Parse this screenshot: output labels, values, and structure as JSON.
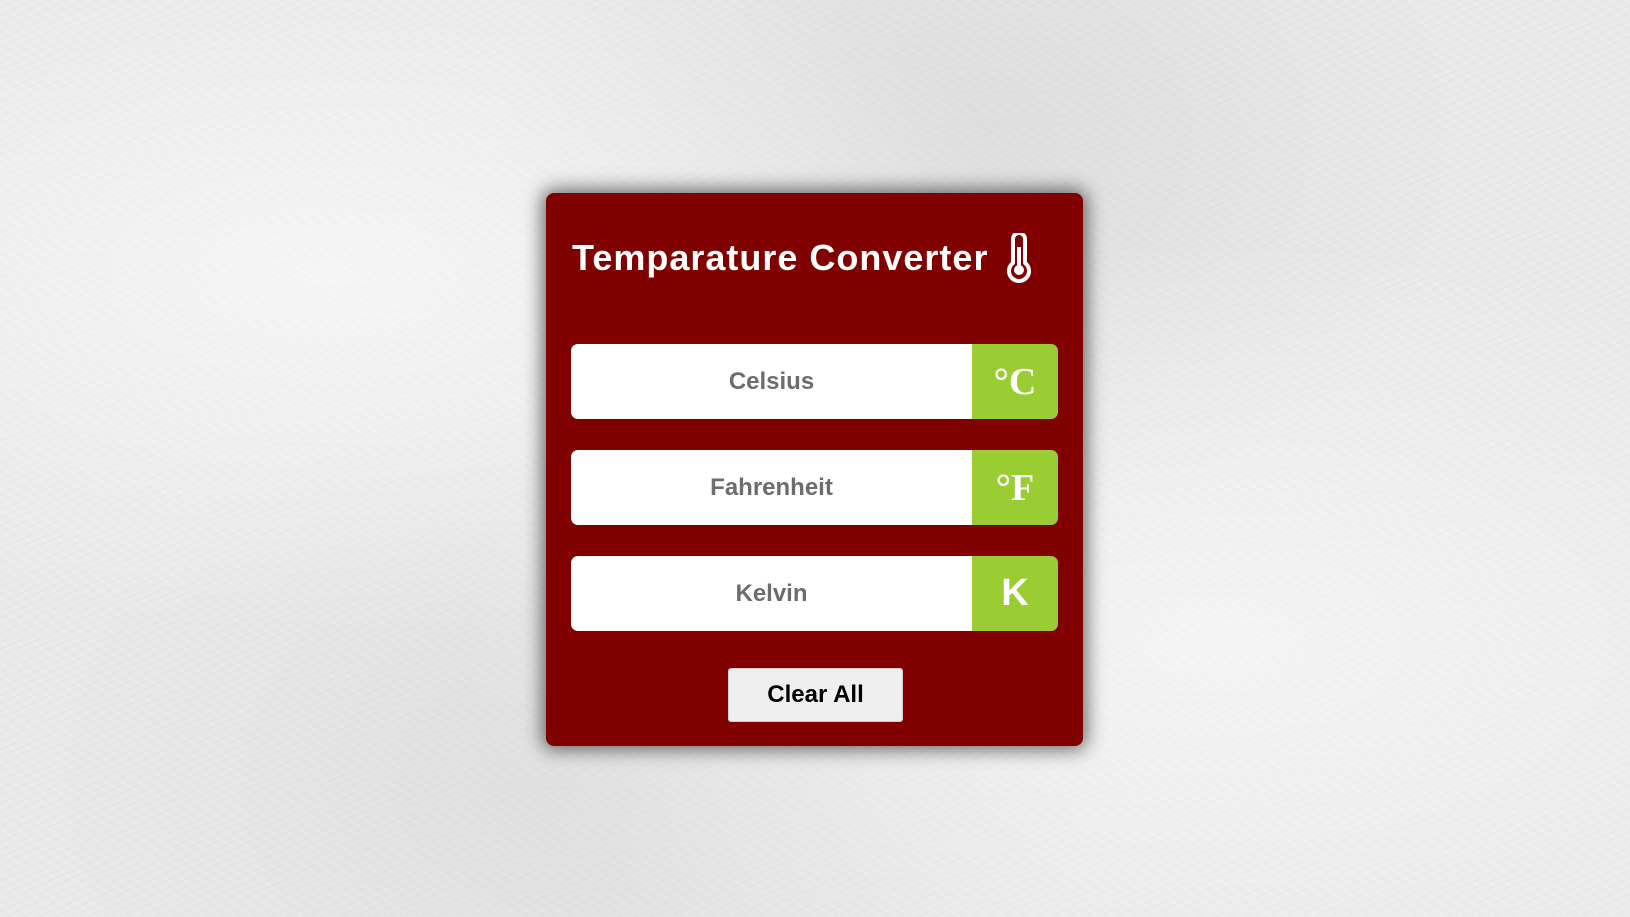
{
  "app": {
    "title": "Temparature Converter",
    "title_icon": "thermometer-icon"
  },
  "fields": [
    {
      "placeholder": "Celsius",
      "value": "",
      "unit": "°C"
    },
    {
      "placeholder": "Fahrenheit",
      "value": "",
      "unit": "°F"
    },
    {
      "placeholder": "Kelvin",
      "value": "",
      "unit": "K"
    }
  ],
  "actions": {
    "clear_label": "Clear All"
  },
  "colors": {
    "card_background": "#800000",
    "unit_badge": "#9acd32",
    "button_background": "#efefef",
    "page_background": "#e9e9e9"
  }
}
